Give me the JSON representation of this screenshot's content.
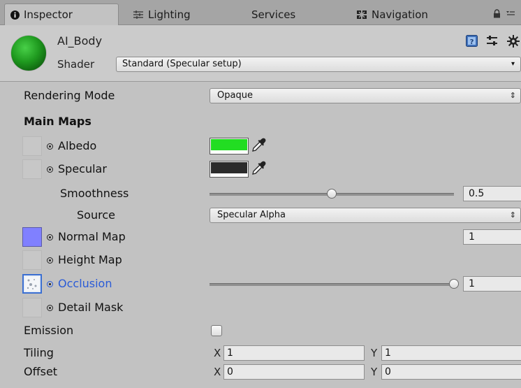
{
  "tabs": {
    "inspector": "Inspector",
    "lighting": "Lighting",
    "services": "Services",
    "navigation": "Navigation"
  },
  "header": {
    "material_name": "AI_Body",
    "shader_label": "Shader",
    "shader_value": "Standard (Specular setup)"
  },
  "properties": {
    "rendering_mode_label": "Rendering Mode",
    "rendering_mode_value": "Opaque",
    "main_maps_label": "Main Maps",
    "albedo_label": "Albedo",
    "albedo_color": "#22dd22",
    "specular_label": "Specular",
    "specular_color": "#2b2b2b",
    "smoothness_label": "Smoothness",
    "smoothness_value": "0.5",
    "smoothness_fraction": 0.5,
    "source_label": "Source",
    "source_value": "Specular Alpha",
    "normal_map_label": "Normal Map",
    "normal_map_value": "1",
    "height_map_label": "Height Map",
    "occlusion_label": "Occlusion",
    "occlusion_value": "1",
    "occlusion_fraction": 1.0,
    "detail_mask_label": "Detail Mask",
    "emission_label": "Emission",
    "tiling_label": "Tiling",
    "tiling_x": "1",
    "tiling_y": "1",
    "offset_label": "Offset",
    "offset_x": "0",
    "offset_y": "0",
    "x_axis": "X",
    "y_axis": "Y"
  },
  "colors": {
    "occlusion_label": "#2a5bd7",
    "normal_map_slot": "#8080ff"
  }
}
